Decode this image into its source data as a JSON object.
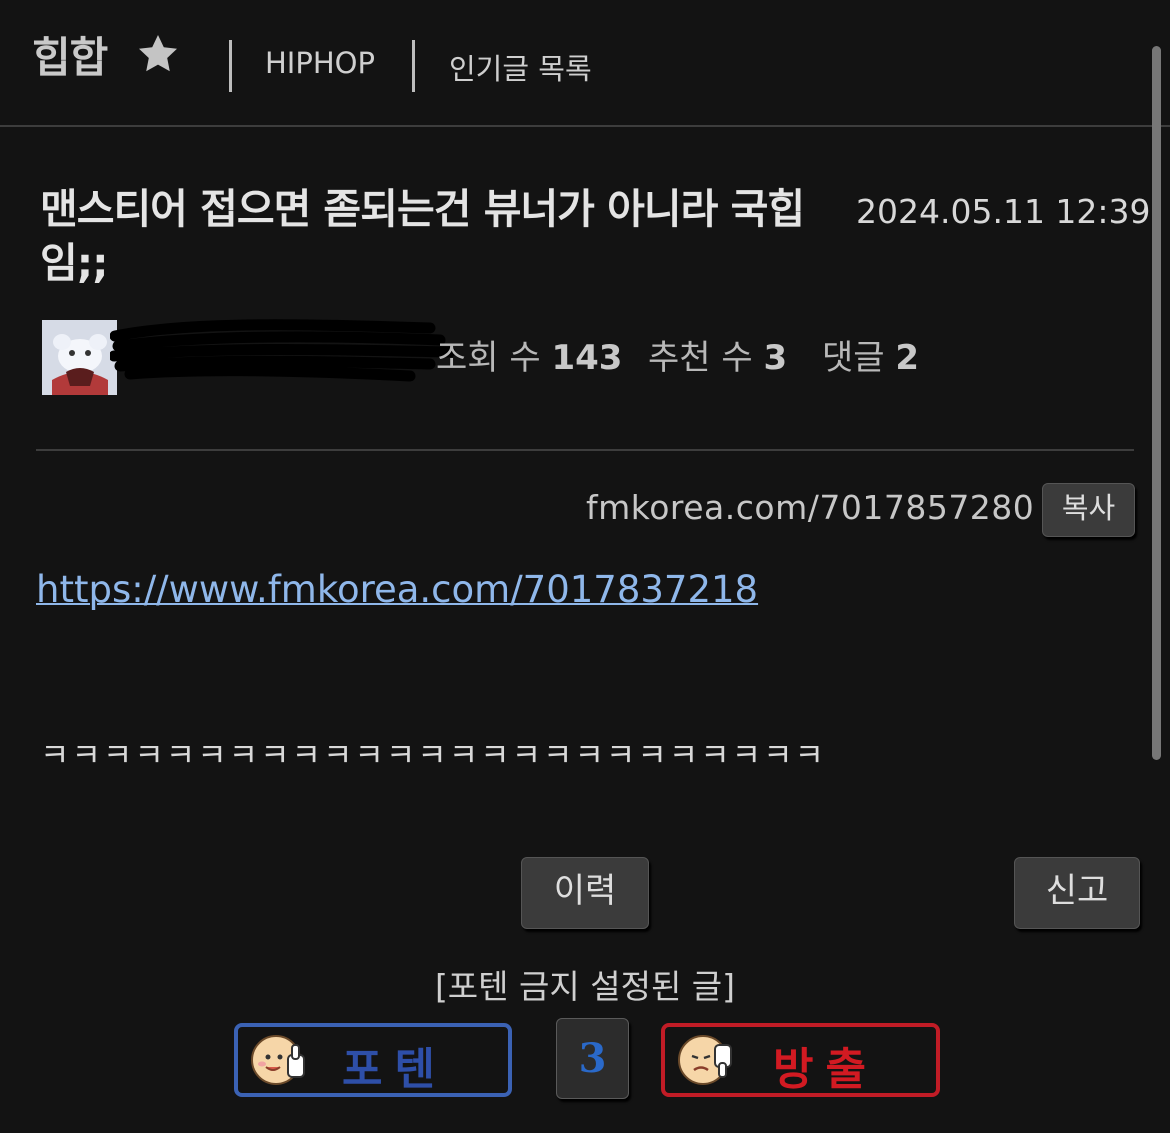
{
  "header": {
    "board_name": "힙합",
    "nav_hiphop": "HIPHOP",
    "nav_popular": "인기글 목록"
  },
  "post": {
    "title": "맨스티어 접으면 졷되는건 뷰너가 아니라 국힙임;;",
    "date": "2024.05.11 12:39",
    "views_label": "조회 수",
    "views": "143",
    "recommend_label": "추천 수",
    "recommend": "3",
    "comments_label": "댓글",
    "comments": "2",
    "short_url": "fmkorea.com/7017857280",
    "copy_label": "복사",
    "link": "https://www.fmkorea.com/7017837218",
    "body_text": "ㅋㅋㅋㅋㅋㅋㅋㅋㅋㅋㅋㅋㅋㅋㅋㅋㅋㅋㅋㅋㅋㅋㅋㅋㅋ"
  },
  "actions": {
    "history_label": "이력",
    "report_label": "신고",
    "notice": "[포텐 금지 설정된 글]",
    "upvote_label": "포텐",
    "downvote_label": "방출",
    "vote_count": "3"
  },
  "colors": {
    "background": "#131313",
    "link": "#8fb7ea",
    "upvote_border": "#3b62b4",
    "downvote_border": "#c11c26",
    "count": "#2a69c9"
  }
}
